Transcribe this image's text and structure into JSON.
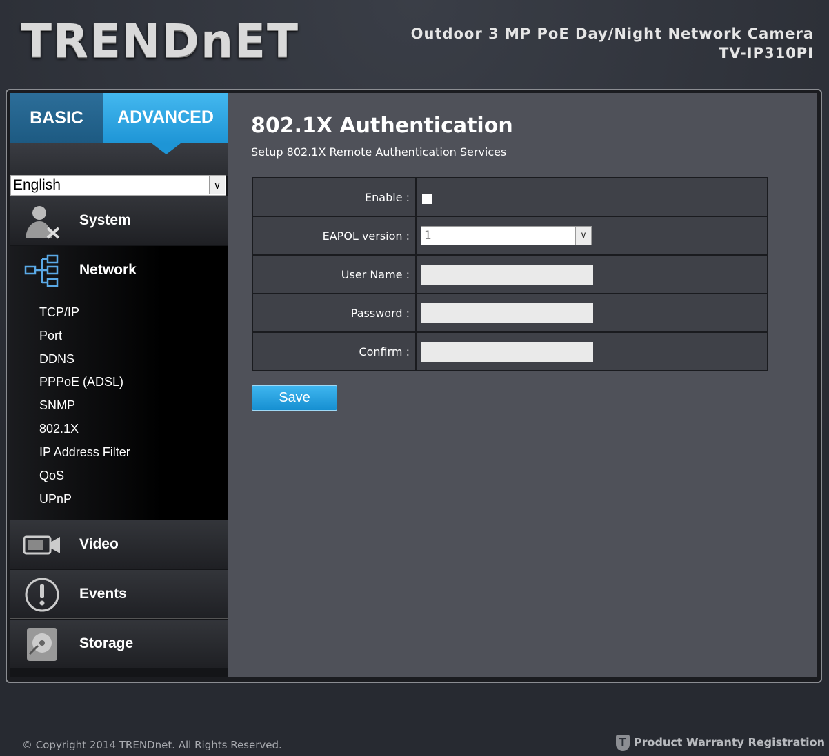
{
  "header": {
    "logo_text": "TRENDnET",
    "product_line1": "Outdoor 3 MP PoE Day/Night Network Camera",
    "product_line2": "TV-IP310PI"
  },
  "tabs": {
    "basic": "BASIC",
    "advanced": "ADVANCED"
  },
  "language": {
    "selected": "English"
  },
  "sidebar": {
    "system": "System",
    "network": "Network",
    "network_items": [
      "TCP/IP",
      "Port",
      "DDNS",
      "PPPoE (ADSL)",
      "SNMP",
      "802.1X",
      "IP Address Filter",
      "QoS",
      "UPnP"
    ],
    "video": "Video",
    "events": "Events",
    "storage": "Storage"
  },
  "page": {
    "title": "802.1X Authentication",
    "subtitle": "Setup 802.1X Remote Authentication Services",
    "enable_label": "Enable :",
    "eapol_label": "EAPOL version :",
    "eapol_value": "1",
    "username_label": "User Name :",
    "password_label": "Password :",
    "confirm_label": "Confirm :",
    "save_label": "Save"
  },
  "footer": {
    "copyright": "© Copyright 2014 TRENDnet. All Rights Reserved.",
    "warranty": "Product Warranty Registration"
  },
  "colors": {
    "accent": "#1e95d6",
    "content_bg": "#4f5159",
    "sidebar_bg": "#141518"
  },
  "icons": [
    "user-tools-icon",
    "network-tree-icon",
    "video-camera-icon",
    "alert-icon",
    "storage-disk-icon",
    "warranty-shield-icon",
    "dropdown-arrow-icon"
  ]
}
